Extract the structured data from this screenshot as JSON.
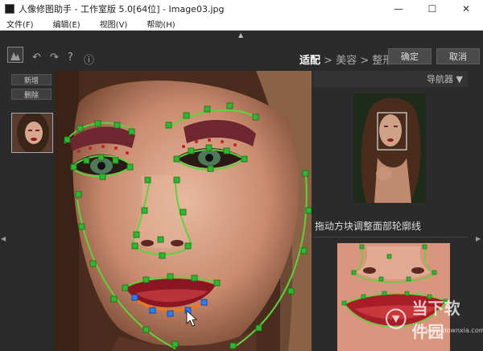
{
  "window": {
    "title": "人像修图助手 - 工作室版 5.0[64位] - Image03.jpg",
    "minimize": "—",
    "maximize": "☐",
    "close": "✕"
  },
  "menu": [
    "文件(F)",
    "编辑(E)",
    "视图(V)",
    "帮助(H)"
  ],
  "toolbar": {
    "undo": "↶",
    "redo": "↷",
    "help": "?",
    "info": "ⓘ",
    "breadcrumb": {
      "step1": "适配",
      "sep1": " > ",
      "step2": "美容",
      "sep2": " > ",
      "step3": "整形"
    },
    "confirm_label": "确定",
    "cancel_label": "取消"
  },
  "left_panel": {
    "add_label": "新增",
    "delete_label": "删除"
  },
  "right_panel": {
    "navigator_label": "导航器 ▼",
    "hint": "拖动方块调整面部轮廓线"
  },
  "watermark": {
    "text": "当下软件园",
    "sub": "www.downxia.com"
  },
  "colors": {
    "contour": "#5fd23a",
    "handle": "#2fb82f",
    "selected_handle": "#2e7bff",
    "lip_outline": "#f07a1a"
  },
  "icons": [
    "app-icon",
    "undo-icon",
    "redo-icon",
    "help-icon",
    "info-icon",
    "image-thumb-icon",
    "collapse-up-icon",
    "expand-left-icon",
    "expand-right-icon",
    "cursor-icon",
    "watermark-logo-icon"
  ]
}
